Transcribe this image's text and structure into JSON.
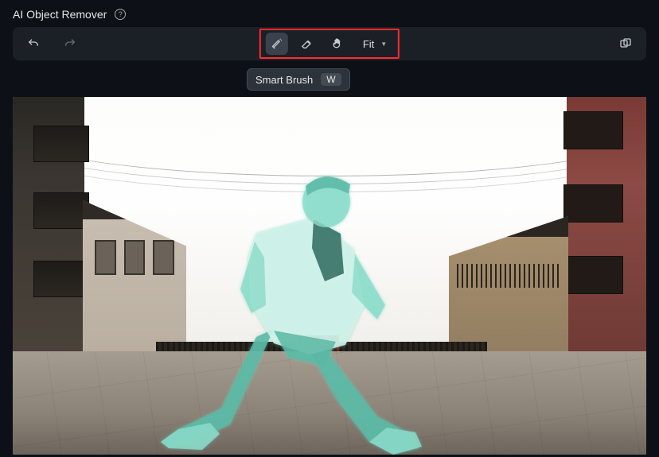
{
  "header": {
    "title": "AI Object Remover"
  },
  "toolbar": {
    "zoom_label": "Fit"
  },
  "tooltip": {
    "label": "Smart Brush",
    "shortcut": "W"
  },
  "icons": {
    "help": "help-icon",
    "undo": "undo-icon",
    "redo": "redo-icon",
    "smart_brush": "smart-brush-icon",
    "eraser": "eraser-icon",
    "hand": "hand-icon",
    "chevron": "chevron-down-icon",
    "compare": "compare-icon"
  },
  "colors": {
    "ai_highlight": "#8edccb",
    "annotation_box": "#ff2a2a"
  }
}
